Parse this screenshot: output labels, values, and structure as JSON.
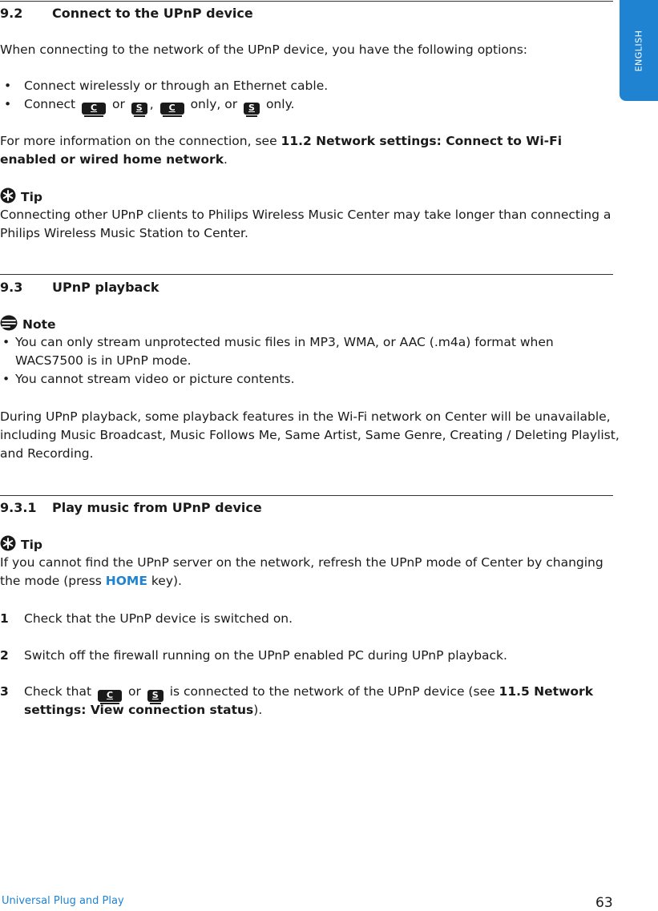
{
  "side_tab": {
    "label": "ENGLISH",
    "color": "#1f83d2"
  },
  "section_9_2": {
    "number": "9.2",
    "title": "Connect to the UPnP device",
    "intro": "When connecting to the network of the UPnP device, you have the following options:",
    "bullets": {
      "b1": "Connect wirelessly or through an Ethernet cable.",
      "b2_prefix": "Connect",
      "b2_or1": "or",
      "b2_comma": ",",
      "b2_only_or": "only, or",
      "b2_only": "only."
    },
    "more_info_prefix": "For more information on the connection, see ",
    "more_info_ref_line1": "11.2 Network settings: Connect to Wi-Fi",
    "more_info_ref_line2": "enabled or wired home network",
    "more_info_suffix": ".",
    "tip": {
      "label": "Tip",
      "line1": "Connecting other UPnP clients to Philips Wireless Music Center may take longer than connecting a",
      "line2": "Philips Wireless Music Station to Center."
    }
  },
  "section_9_3": {
    "number": "9.3",
    "title": "UPnP playback",
    "note": {
      "label": "Note",
      "items": {
        "i1_line1": "You can only stream unprotected music files in MP3, WMA, or AAC (.m4a) format when",
        "i1_line2": "WACS7500 is in UPnP mode.",
        "i2": "You cannot stream video or picture contents."
      }
    },
    "para_line1": "During UPnP playback, some playback features in the Wi-Fi network on Center will be unavailable,",
    "para_line2": "including Music Broadcast, Music Follows Me, Same Artist, Same Genre, Creating / Deleting Playlist,",
    "para_line3": "and Recording."
  },
  "section_9_3_1": {
    "number": "9.3.1",
    "title": "Play music from UPnP device",
    "tip": {
      "label": "Tip",
      "line1": "If you cannot find the UPnP server on the network, refresh the UPnP mode of Center by changing",
      "line2_prefix": "the mode (press ",
      "line2_key": "HOME",
      "line2_suffix": " key)."
    },
    "steps": {
      "s1_num": "1",
      "s1": "Check that the UPnP device is switched on.",
      "s2_num": "2",
      "s2": "Switch off the firewall running on the UPnP enabled PC during UPnP playback.",
      "s3_num": "3",
      "s3_prefix": "Check that",
      "s3_or": "or",
      "s3_mid": "is connected to the network of the UPnP device (see ",
      "s3_ref1": "11.5 Network",
      "s3_ref2": "settings: View connection status",
      "s3_suffix": ")."
    }
  },
  "keys": {
    "center": "C",
    "station": "S"
  },
  "footer": {
    "section": "Universal Plug and Play",
    "page": "63"
  }
}
